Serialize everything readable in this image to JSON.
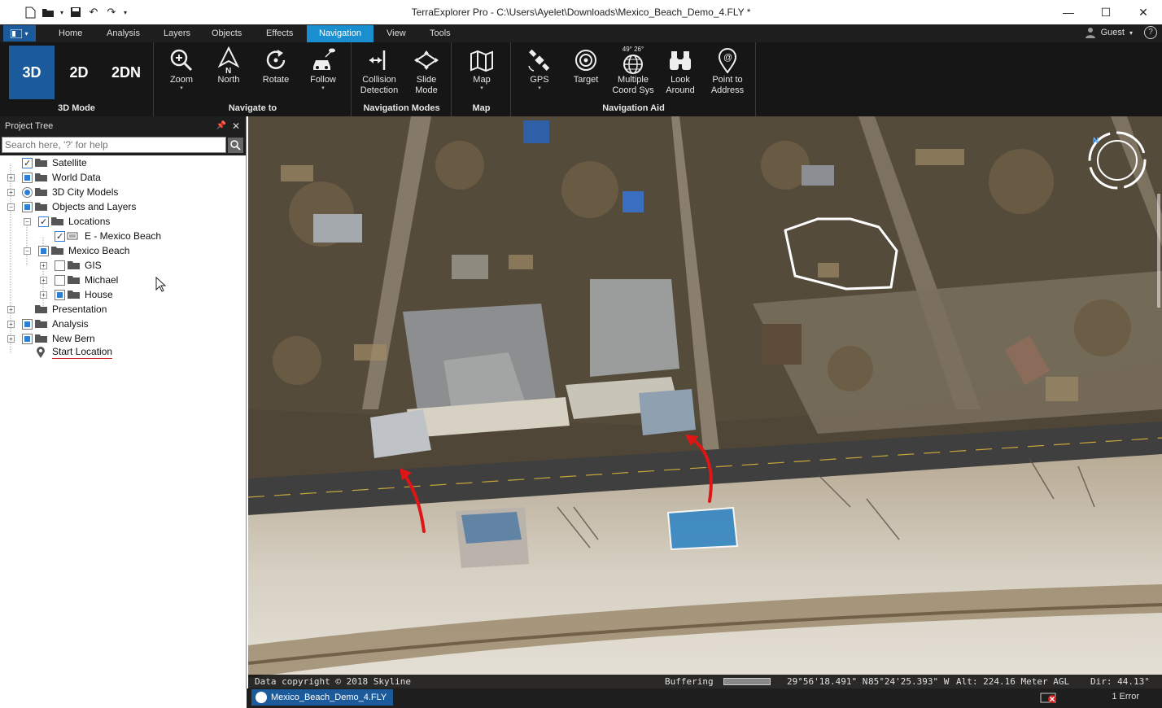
{
  "window": {
    "title": "TerraExplorer Pro - C:\\Users\\Ayelet\\Downloads\\Mexico_Beach_Demo_4.FLY *"
  },
  "menu": {
    "tabs": [
      "Home",
      "Analysis",
      "Layers",
      "Objects",
      "Effects",
      "Navigation",
      "View",
      "Tools"
    ],
    "active_tab": "Navigation",
    "user_label": "Guest"
  },
  "ribbon": {
    "mode_group": {
      "label": "3D Mode",
      "buttons": [
        "3D",
        "2D",
        "2DN"
      ]
    },
    "navigate_group": {
      "label": "Navigate to",
      "buttons": [
        {
          "label": "Zoom",
          "icon": "zoom-icon"
        },
        {
          "label": "North",
          "icon": "north-icon"
        },
        {
          "label": "Rotate",
          "icon": "rotate-icon"
        },
        {
          "label": "Follow",
          "icon": "follow-icon"
        }
      ]
    },
    "modes_group": {
      "label": "Navigation Modes",
      "buttons": [
        {
          "label1": "Collision",
          "label2": "Detection"
        },
        {
          "label1": "Slide",
          "label2": "Mode"
        }
      ]
    },
    "map_group": {
      "label": "Map",
      "button": "Map"
    },
    "aid_group": {
      "label": "Navigation Aid",
      "coord_hint": "49° 26°",
      "buttons": [
        {
          "label1": "GPS",
          "label2": ""
        },
        {
          "label1": "Target",
          "label2": ""
        },
        {
          "label1": "Multiple",
          "label2": "Coord Sys"
        },
        {
          "label1": "Look",
          "label2": "Around"
        },
        {
          "label1": "Point to",
          "label2": "Address"
        }
      ]
    }
  },
  "project_tree": {
    "title": "Project Tree",
    "search_placeholder": "Search here, '?' for help",
    "items": [
      {
        "label": "Satellite"
      },
      {
        "label": "World Data"
      },
      {
        "label": "3D City Models"
      },
      {
        "label": "Objects and Layers"
      },
      {
        "label": "Locations"
      },
      {
        "label": "E - Mexico Beach"
      },
      {
        "label": "Mexico Beach"
      },
      {
        "label": "GIS"
      },
      {
        "label": "Michael"
      },
      {
        "label": "House"
      },
      {
        "label": "Presentation"
      },
      {
        "label": "Analysis"
      },
      {
        "label": "New Bern"
      },
      {
        "label": "Start Location"
      }
    ]
  },
  "view": {
    "copyright": "Data copyright © 2018 Skyline",
    "buffering": "Buffering",
    "lat": "29°56'18.491\" N",
    "lon": "85°24'25.393\" W",
    "alt": "Alt: 224.16 Meter AGL",
    "dir": "Dir: 44.13°",
    "compass_label": "N"
  },
  "bottom": {
    "document_tab": "Mexico_Beach_Demo_4.FLY",
    "errors": "1 Error"
  }
}
